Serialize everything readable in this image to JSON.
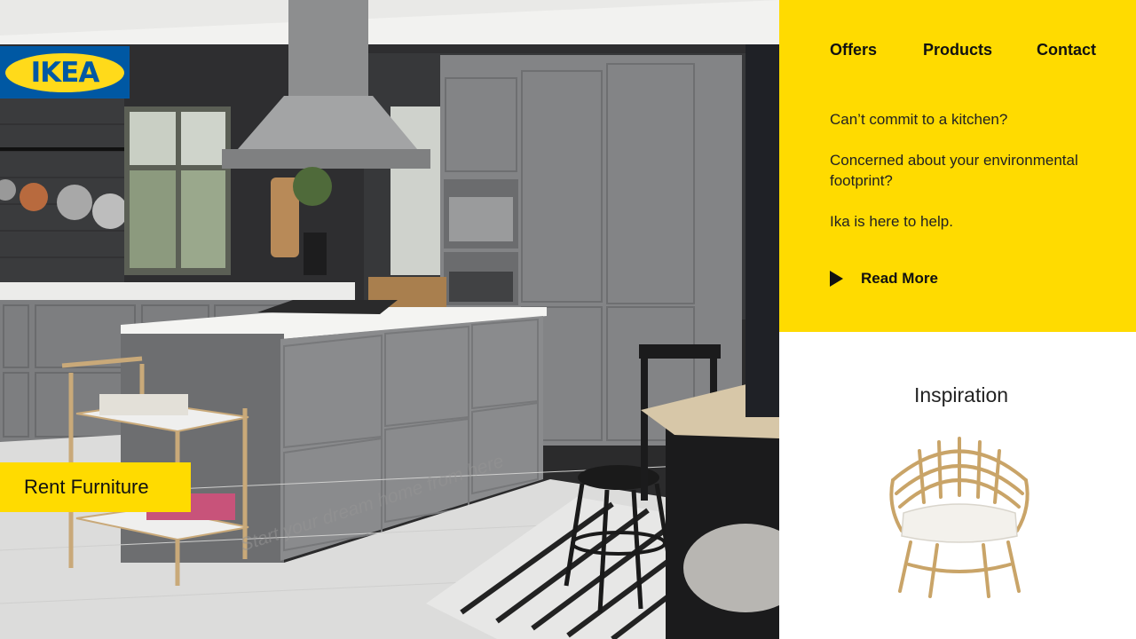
{
  "brand": {
    "logo_text": "IKEA",
    "blue": "#0058a3",
    "yellow": "#ffda1a"
  },
  "nav": [
    {
      "label": "Offers"
    },
    {
      "label": "Products"
    },
    {
      "label": "Contact"
    }
  ],
  "copy": [
    "Can’t commit to a kitchen?",
    "Concerned about your environmental footprint?",
    "Ika is here to help."
  ],
  "read_more": {
    "label": "Read More",
    "icon": "play-icon"
  },
  "hero": {
    "cta_label": "Rent Furniture",
    "tagline": "Start your dream home from here"
  },
  "inspiration": {
    "title": "Inspiration",
    "image": "rattan-armchair"
  },
  "colors": {
    "accent": "#ffdb00",
    "text": "#111111"
  }
}
